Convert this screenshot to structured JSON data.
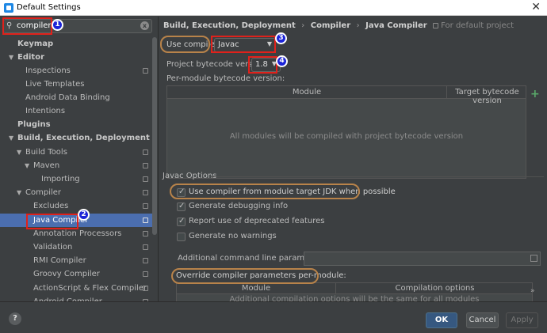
{
  "window": {
    "title": "Default Settings",
    "close_glyph": "✕"
  },
  "search": {
    "value": "compiler",
    "icon": "search-icon",
    "clear_glyph": "x"
  },
  "tree": [
    {
      "label": "Keymap",
      "bold": true,
      "arrow": "",
      "copy": false
    },
    {
      "label": "Editor",
      "bold": true,
      "arrow": "▼",
      "copy": false
    },
    {
      "label": "Inspections",
      "bold": false,
      "arrow": "",
      "copy": true
    },
    {
      "label": "Live Templates",
      "bold": false,
      "arrow": "",
      "copy": false
    },
    {
      "label": "Android Data Binding",
      "bold": false,
      "arrow": "",
      "copy": false
    },
    {
      "label": "Intentions",
      "bold": false,
      "arrow": "",
      "copy": false
    },
    {
      "label": "Plugins",
      "bold": true,
      "arrow": "",
      "copy": false
    },
    {
      "label": "Build, Execution, Deployment",
      "bold": true,
      "arrow": "▼",
      "copy": false
    },
    {
      "label": "Build Tools",
      "bold": false,
      "arrow": "▼",
      "copy": true
    },
    {
      "label": "Maven",
      "bold": false,
      "arrow": "▼",
      "copy": true
    },
    {
      "label": "Importing",
      "bold": false,
      "arrow": "",
      "copy": true
    },
    {
      "label": "Compiler",
      "bold": false,
      "arrow": "▼",
      "copy": true
    },
    {
      "label": "Excludes",
      "bold": false,
      "arrow": "",
      "copy": true
    },
    {
      "label": "Java Compiler",
      "bold": false,
      "arrow": "",
      "copy": true,
      "selected": true
    },
    {
      "label": "Annotation Processors",
      "bold": false,
      "arrow": "",
      "copy": true
    },
    {
      "label": "Validation",
      "bold": false,
      "arrow": "",
      "copy": true
    },
    {
      "label": "RMI Compiler",
      "bold": false,
      "arrow": "",
      "copy": true
    },
    {
      "label": "Groovy Compiler",
      "bold": false,
      "arrow": "",
      "copy": true
    },
    {
      "label": "ActionScript & Flex Compiler",
      "bold": false,
      "arrow": "",
      "copy": true
    },
    {
      "label": "Android Compiler",
      "bold": false,
      "arrow": "",
      "copy": true
    }
  ],
  "breadcrumb": {
    "part1": "Build, Execution, Deployment",
    "part2": "Compiler",
    "part3": "Java Compiler",
    "separator": "›",
    "note": "For default project"
  },
  "compiler": {
    "label": "Use compiler:",
    "value": "Javac"
  },
  "bytecode": {
    "label": "Project bytecode version:",
    "value": "1.8"
  },
  "per_module": {
    "label": "Per-module bytecode version:",
    "col_module": "Module",
    "col_target": "Target bytecode version",
    "empty": "All modules will be compiled with project bytecode version",
    "add_glyph": "+"
  },
  "javac": {
    "section": "Javac Options",
    "options": [
      {
        "label": "Use compiler from module target JDK when possible",
        "checked": true
      },
      {
        "label": "Generate debugging info",
        "checked": true
      },
      {
        "label": "Report use of deprecated features",
        "checked": true
      },
      {
        "label": "Generate no warnings",
        "checked": false
      }
    ],
    "cmd_label": "Additional command line parameters:",
    "cmd_value": "",
    "override_label": "Override compiler parameters per-module:",
    "col_module": "Module",
    "col_options": "Compilation options",
    "empty": "Additional compilation options will be the same for all modules"
  },
  "badges": [
    "1",
    "2",
    "3",
    "4"
  ],
  "footer": {
    "help": "?",
    "ok": "OK",
    "cancel": "Cancel",
    "apply": "Apply"
  },
  "colors": {
    "selection": "#4b6eaf",
    "annotation_red": "#e0211b",
    "annotation_blue": "#1c24d8",
    "ring_orange": "#b8834a",
    "ok_button": "#365880"
  }
}
